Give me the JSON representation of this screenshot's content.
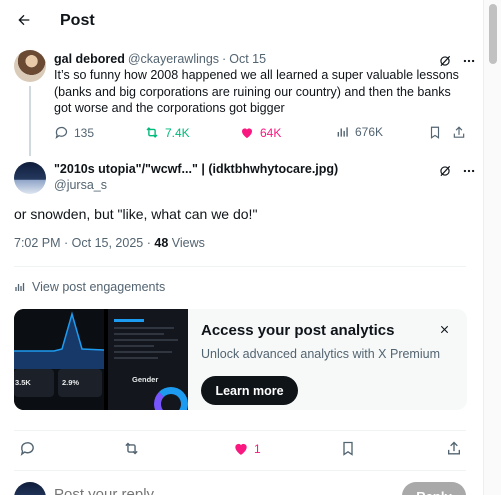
{
  "header": {
    "title": "Post",
    "back_icon": "arrow-left-icon"
  },
  "parent_post": {
    "author_name": "gal debored",
    "author_handle": "@ckayerawlings",
    "time": "Oct 15",
    "text": "It’s so funny how 2008 happened we all learned a super valuable lessons (banks and big corporations are ruining our country) and then the banks got worse and the corporations got bigger",
    "replies": "135",
    "reposts": "7.4K",
    "likes": "64K",
    "views": "676K",
    "colors": {
      "repost_active": "#00ba7c",
      "like_active": "#f91880",
      "muted": "#536471"
    }
  },
  "main_post": {
    "author_name": "\"2010s utopia\"/\"wcwf...\" | (idktbhwhytocare.jpg)",
    "author_handle": "@jursa_s",
    "text": "or snowden, but \"like, what can we do!\"",
    "timestamp": "7:02 PM · Oct 15, 2025",
    "views_count": "48",
    "views_label": "Views",
    "likes": "1"
  },
  "engagements_link": "View post engagements",
  "promo": {
    "title": "Access your post analytics",
    "subtitle": "Unlock advanced analytics with X Premium",
    "button": "Learn more",
    "mini_stat_1": "3.5K",
    "mini_stat_2": "2.9%",
    "mini_label": "Gender"
  },
  "reply": {
    "placeholder": "Post your reply",
    "button": "Reply"
  },
  "separator": "·"
}
